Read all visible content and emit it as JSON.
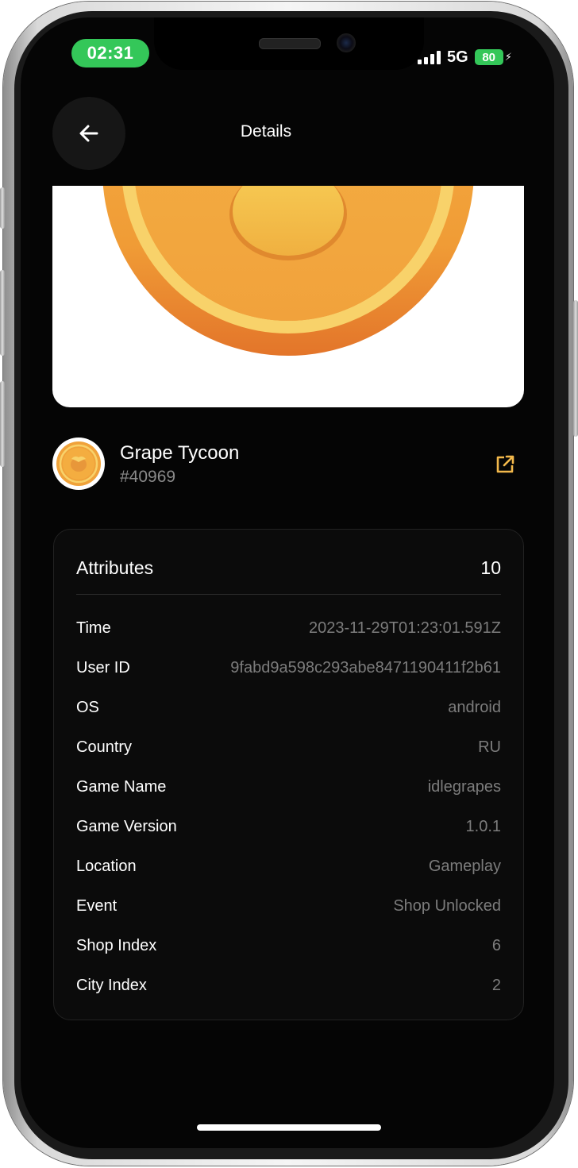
{
  "status_bar": {
    "time": "02:31",
    "network": "5G",
    "battery": "80"
  },
  "header": {
    "title": "Details",
    "back_icon": "arrow-left-icon"
  },
  "game": {
    "name": "Grape Tycoon",
    "id": "#40969",
    "link_icon": "external-link-icon",
    "accent_color": "#f2b84b"
  },
  "attributes": {
    "title": "Attributes",
    "count": "10",
    "rows": [
      {
        "key": "Time",
        "value": "2023-11-29T01:23:01.591Z"
      },
      {
        "key": "User ID",
        "value": "9fabd9a598c293abe8471190411f2b61"
      },
      {
        "key": "OS",
        "value": "android"
      },
      {
        "key": "Country",
        "value": "RU"
      },
      {
        "key": "Game Name",
        "value": "idlegrapes"
      },
      {
        "key": "Game Version",
        "value": "1.0.1"
      },
      {
        "key": "Location",
        "value": "Gameplay"
      },
      {
        "key": "Event",
        "value": "Shop Unlocked"
      },
      {
        "key": "Shop Index",
        "value": "6"
      },
      {
        "key": "City Index",
        "value": "2"
      }
    ]
  },
  "colors": {
    "background": "#050505",
    "card": "#0b0b0b",
    "status_green": "#34c759",
    "muted_text": "#7c7c7c"
  }
}
